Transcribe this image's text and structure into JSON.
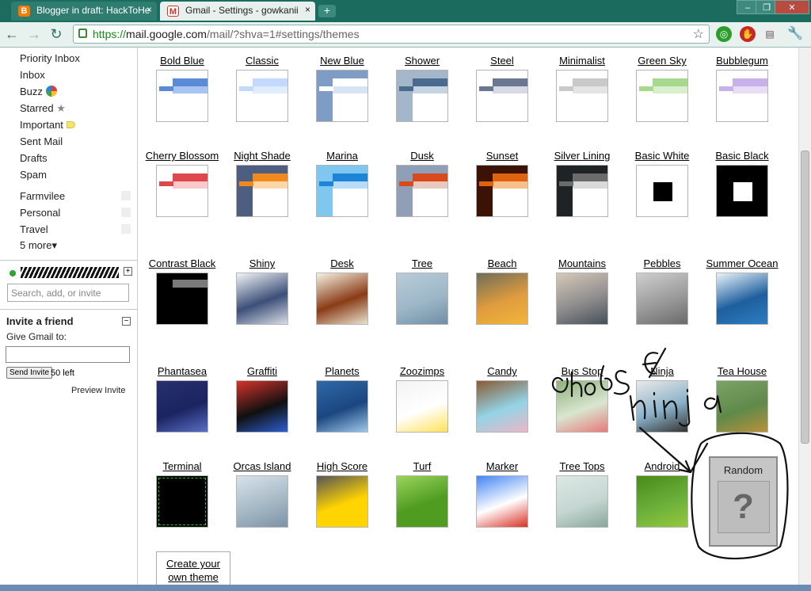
{
  "browser": {
    "tabs": [
      {
        "title": "Blogger in draft: HackToHe",
        "icon": "blogger-icon",
        "color": "#f57c00"
      },
      {
        "title": "Gmail - Settings - gowkanii",
        "icon": "gmail-icon",
        "color": "#d93025"
      }
    ],
    "new_tab_label": "+",
    "window_controls": [
      "–",
      "❐",
      "✕"
    ],
    "url_scheme": "https://",
    "url_host": "mail.google.com",
    "url_path": "/mail/?shva=1#settings/themes",
    "nav_icons": [
      "back-icon",
      "forward-icon",
      "reload-icon"
    ]
  },
  "sidebar": {
    "items": [
      "Priority Inbox",
      "Inbox",
      "Buzz",
      "Starred",
      "Important",
      "Sent Mail",
      "Drafts",
      "Spam"
    ],
    "labels": [
      "Farmvilee",
      "Personal",
      "Travel"
    ],
    "more": "5 more▾",
    "chat_search_placeholder": "Search, add, or invite",
    "invite": {
      "title": "Invite a friend",
      "give_label": "Give Gmail to:",
      "send_button": "Send Invite",
      "left_count": "50 left",
      "preview": "Preview Invite"
    },
    "collapse_icon": "−",
    "expand_icon": "+"
  },
  "themes": [
    {
      "name": "Bold Blue",
      "c1": "#5b8ad6",
      "c2": "#a8c4f2",
      "bg": "#fff"
    },
    {
      "name": "Classic",
      "c1": "#c3d9ff",
      "c2": "#e0ecff",
      "bg": "#fff"
    },
    {
      "name": "New Blue",
      "c1": "#fff",
      "c2": "#d8e4f6",
      "bg": "#7f9cc4"
    },
    {
      "name": "Shower",
      "c1": "#4a6a90",
      "c2": "#c6d3e2",
      "bg": "#a4b6ca"
    },
    {
      "name": "Steel",
      "c1": "#6b7690",
      "c2": "#d7dae4",
      "bg": "#fff"
    },
    {
      "name": "Minimalist",
      "c1": "#c9c9c9",
      "c2": "#e4e4e4",
      "bg": "#fff"
    },
    {
      "name": "Green Sky",
      "c1": "#a6d88e",
      "c2": "#d9efcb",
      "bg": "#fff"
    },
    {
      "name": "Bubblegum",
      "c1": "#c8b0ea",
      "c2": "#e8dcf6",
      "bg": "#fff"
    },
    {
      "name": "Cherry Blossom",
      "c1": "#e0474c",
      "c2": "#f7c9cb",
      "bg": "#fff"
    },
    {
      "name": "Night Shade",
      "c1": "#f08a1c",
      "c2": "#fdd6aa",
      "bg": "#4d5e80"
    },
    {
      "name": "Marina",
      "c1": "#1d84d6",
      "c2": "#b8dcf7",
      "bg": "#7fc7ef"
    },
    {
      "name": "Dusk",
      "c1": "#d8491b",
      "c2": "#e7c9c0",
      "bg": "#8f9fb8"
    },
    {
      "name": "Sunset",
      "c1": "#e0620e",
      "c2": "#f6c08c",
      "bg": "#3b1305"
    },
    {
      "name": "Silver Lining",
      "c1": "#6b6b6b",
      "c2": "#d9d9d9",
      "bg": "#1f2326"
    },
    {
      "name": "Basic White",
      "c1": "#000",
      "c2": "#fff",
      "bg": "#fff"
    },
    {
      "name": "Basic Black",
      "c1": "#fff",
      "c2": "#000",
      "bg": "#000"
    },
    {
      "name": "Contrast Black",
      "c1": "#7a7a7a",
      "c2": "#2a2a2a",
      "bg": "#000"
    },
    {
      "name": "Shiny",
      "c1": "#d8dde6",
      "c2": "#f2f4f7",
      "bg": "#3c4f78"
    },
    {
      "name": "Desk",
      "c1": "#e8e3cf",
      "c2": "#f6f2e3",
      "bg": "#8a3b16"
    },
    {
      "name": "Tree",
      "c1": "#6f8ea5",
      "c2": "#b8ccd8",
      "bg": "#9db7c8"
    },
    {
      "name": "Beach",
      "c1": "#f2b53a",
      "c2": "#6e6d5a",
      "bg": "#e09c3e"
    },
    {
      "name": "Mountains",
      "c1": "#455058",
      "c2": "#d6c9b9",
      "bg": "#8f8d8e"
    },
    {
      "name": "Pebbles",
      "c1": "#6a6a6a",
      "c2": "#cfcfcf",
      "bg": "#9a9a9a"
    },
    {
      "name": "Summer Ocean",
      "c1": "#2c7dc1",
      "c2": "#e9f3fa",
      "bg": "#1e5f9e"
    },
    {
      "name": "Phantasea",
      "c1": "#5b6ec4",
      "c2": "#27306e",
      "bg": "#1a2460"
    },
    {
      "name": "Graffiti",
      "c1": "#2c5fd0",
      "c2": "#d5342b",
      "bg": "#101010"
    },
    {
      "name": "Planets",
      "c1": "#9ec8ea",
      "c2": "#2e6aa8",
      "bg": "#1b4680"
    },
    {
      "name": "Zoozimps",
      "c1": "#ffe25a",
      "c2": "#f3f3f3",
      "bg": "#fff"
    },
    {
      "name": "Candy",
      "c1": "#e9b8c7",
      "c2": "#8a5a34",
      "bg": "#93d4e6"
    },
    {
      "name": "Bus Stop",
      "c1": "#e87a7a",
      "c2": "#8fb07a",
      "bg": "#d8e6d0"
    },
    {
      "name": "Ninja",
      "c1": "#333",
      "c2": "#e9e9e9",
      "bg": "#8ab1c8"
    },
    {
      "name": "Tea House",
      "c1": "#b9903b",
      "c2": "#7da267",
      "bg": "#5f8a4a"
    },
    {
      "name": "Terminal",
      "c1": "#22c322",
      "c2": "#000",
      "bg": "#000"
    },
    {
      "name": "Orcas Island",
      "c1": "#7b92a6",
      "c2": "#d6e2ea",
      "bg": "#a7b9c6"
    },
    {
      "name": "High Score",
      "c1": "#ffd400",
      "c2": "#555",
      "bg": "#ffd400"
    },
    {
      "name": "Turf",
      "c1": "#4f9c21",
      "c2": "#9bd45c",
      "bg": "#4f9c21"
    },
    {
      "name": "Marker",
      "c1": "#d93025",
      "c2": "#4285f4",
      "bg": "#fff"
    },
    {
      "name": "Tree Tops",
      "c1": "#8aa79a",
      "c2": "#dde8e4",
      "bg": "#c5d7d2"
    },
    {
      "name": "Android",
      "c1": "#95c83d",
      "c2": "#4b8a18",
      "bg": "#6bb03b"
    }
  ],
  "random": {
    "label": "Random",
    "glyph": "?"
  },
  "create_theme": {
    "label": "Create your own theme"
  },
  "annotation": {
    "text": "choose",
    "ninja_scribble": "ninja"
  }
}
